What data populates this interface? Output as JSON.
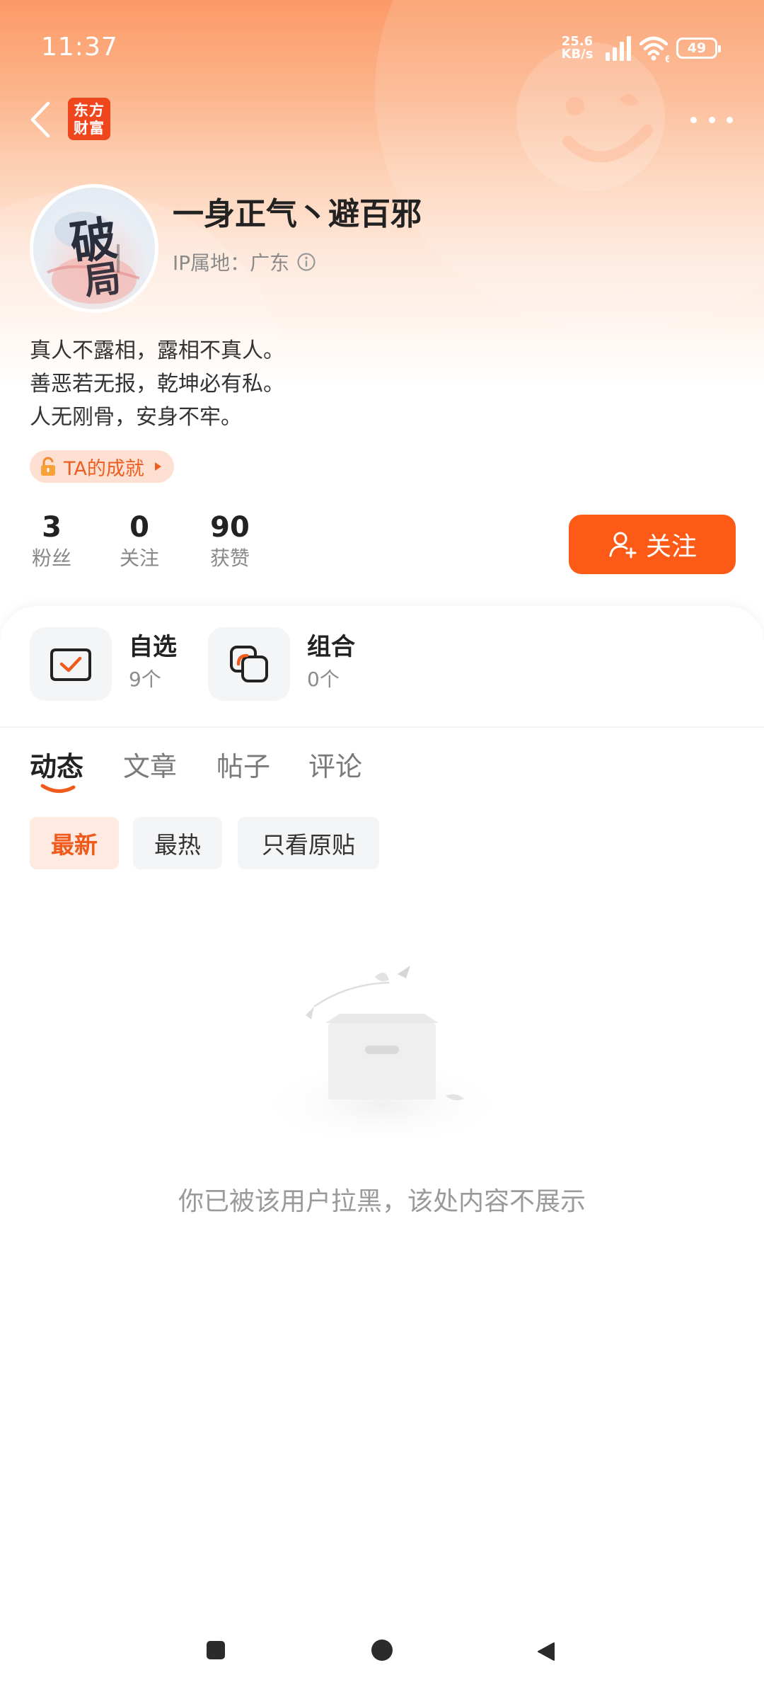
{
  "status_bar": {
    "time": "11:37",
    "net_speed_value": "25.6",
    "net_speed_unit": "KB/s",
    "wifi_badge": "6",
    "battery": "49"
  },
  "app": {
    "logo_line1": "东方",
    "logo_line2": "财富",
    "brand_color": "#fc5a16"
  },
  "profile": {
    "username": "一身正气丶避百邪",
    "ip_location": "IP属地：广东",
    "avatar_text_main": "破",
    "avatar_text_sub": "局",
    "bio": [
      "真人不露相，露相不真人。",
      "善恶若无报，乾坤必有私。",
      "人无刚骨，安身不牢。"
    ],
    "achievement_label": "TA的成就"
  },
  "stats": {
    "fans": {
      "value": "3",
      "label": "粉丝"
    },
    "following": {
      "value": "0",
      "label": "关注"
    },
    "likes": {
      "value": "90",
      "label": "获赞"
    }
  },
  "follow_button": {
    "label": "关注"
  },
  "quick_items": [
    {
      "title": "自选",
      "count": "9个"
    },
    {
      "title": "组合",
      "count": "0个"
    }
  ],
  "tabs": [
    {
      "label": "动态",
      "active": true
    },
    {
      "label": "文章",
      "active": false
    },
    {
      "label": "帖子",
      "active": false
    },
    {
      "label": "评论",
      "active": false
    }
  ],
  "filters": [
    {
      "label": "最新",
      "active": true
    },
    {
      "label": "最热",
      "active": false
    },
    {
      "label": "只看原贴",
      "active": false
    }
  ],
  "empty_state": {
    "message": "你已被该用户拉黑，该处内容不展示"
  }
}
